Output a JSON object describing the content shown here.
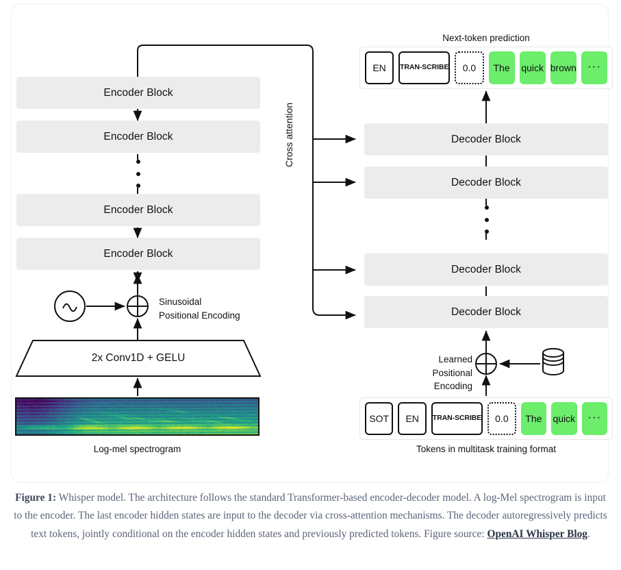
{
  "figure": {
    "caption_label": "Figure 1:",
    "caption_body": " Whisper model. The architecture follows the standard Transformer-based encoder-decoder model. A log-Mel spectrogram is input to the encoder. The last encoder hidden states are input to the decoder via cross-attention mechanisms. The decoder autoregressively predicts text tokens, jointly conditional on the encoder hidden states and previously predicted tokens. Figure source: ",
    "caption_link": "OpenAI Whisper Blog",
    "caption_tail": "."
  },
  "encoder": {
    "block_label": "Encoder Block",
    "blocks": [
      {
        "label": "Encoder Block"
      },
      {
        "label": "Encoder Block"
      },
      {
        "label": "Encoder Block"
      },
      {
        "label": "Encoder Block"
      }
    ],
    "ellipsis": "vertical-dots",
    "conv_label": "2x Conv1D + GELU",
    "pos_encoding_line1": "Sinusoidal",
    "pos_encoding_line2": "Positional Encoding",
    "sine_icon": "sine-wave-icon",
    "add_icon": "circled-plus-icon",
    "spectrogram_caption": "Log-mel spectrogram"
  },
  "decoder": {
    "block_label": "Decoder Block",
    "blocks": [
      {
        "label": "Decoder Block"
      },
      {
        "label": "Decoder Block"
      },
      {
        "label": "Decoder Block"
      },
      {
        "label": "Decoder Block"
      }
    ],
    "ellipsis": "vertical-dots",
    "pos_encoding_line1": "Learned",
    "pos_encoding_line2": "Positional Encoding",
    "database_icon": "database-cylinder-icon",
    "add_icon": "circled-plus-icon",
    "tokens_caption": "Tokens in multitask training format"
  },
  "cross_attention": {
    "label": "Cross attention",
    "arrow_count": 4
  },
  "next_token_prediction": {
    "title": "Next-token prediction",
    "tokens": [
      {
        "text": "EN",
        "style": "solid",
        "size": "normal"
      },
      {
        "text": "TRAN-\nSCRIBE",
        "style": "solid",
        "size": "small"
      },
      {
        "text": "0.0",
        "style": "dotted",
        "size": "normal"
      },
      {
        "text": "The",
        "style": "green",
        "size": "normal"
      },
      {
        "text": "quick",
        "style": "green",
        "size": "normal"
      },
      {
        "text": "brown",
        "style": "green",
        "size": "normal"
      },
      {
        "text": "···",
        "style": "green",
        "size": "dots"
      }
    ]
  },
  "input_tokens": {
    "tokens": [
      {
        "text": "SOT",
        "style": "solid",
        "size": "normal"
      },
      {
        "text": "EN",
        "style": "solid",
        "size": "normal"
      },
      {
        "text": "TRAN-\nSCRIBE",
        "style": "solid",
        "size": "small"
      },
      {
        "text": "0.0",
        "style": "dotted",
        "size": "normal"
      },
      {
        "text": "The",
        "style": "green",
        "size": "normal"
      },
      {
        "text": "quick",
        "style": "green",
        "size": "normal"
      },
      {
        "text": "···",
        "style": "green",
        "size": "dots"
      }
    ]
  },
  "colors": {
    "block_gray": "#ececec",
    "token_green": "#6ced6c",
    "stroke": "#111111",
    "card_border": "#f0f0f2",
    "caption_text": "#5a6378"
  }
}
